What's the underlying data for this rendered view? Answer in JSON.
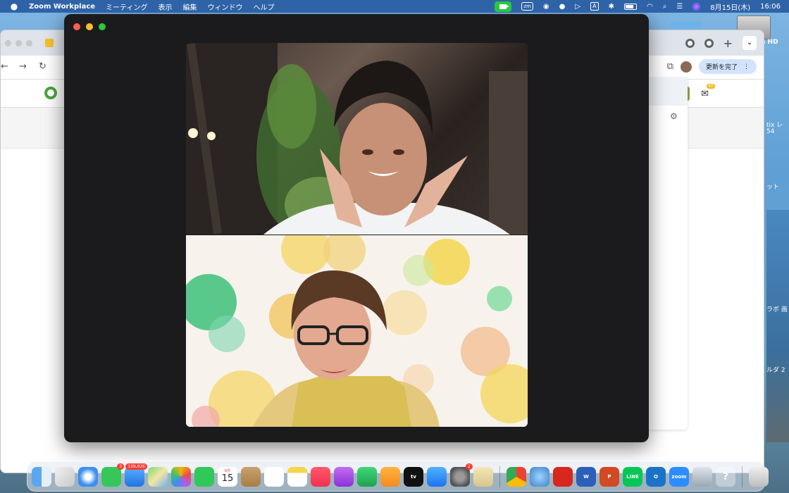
{
  "menubar": {
    "app_name": "Zoom Workplace",
    "menus": [
      "ミーティング",
      "表示",
      "編集",
      "ウィンドウ",
      "ヘルプ"
    ],
    "zoom_icon_text": "zm",
    "input_icon_text": "A",
    "date": "8月15日(木)",
    "time": "16:06"
  },
  "desktop": {
    "disk_label": "n HD",
    "side_labels": [
      "tix レ",
      "54",
      "ット",
      "ラボ 画",
      "ルダ 2"
    ]
  },
  "browser": {
    "update_button": "更新を完了",
    "mail_badge": "40"
  },
  "dock": {
    "items": [
      {
        "name": "finder",
        "label": ""
      },
      {
        "name": "launchpad",
        "label": ""
      },
      {
        "name": "safari",
        "label": ""
      },
      {
        "name": "messages",
        "label": "",
        "badge": "3"
      },
      {
        "name": "mail",
        "label": "",
        "badge": "139,026"
      },
      {
        "name": "maps",
        "label": ""
      },
      {
        "name": "photos",
        "label": ""
      },
      {
        "name": "facetime",
        "label": ""
      },
      {
        "name": "calendar",
        "label": "15",
        "month": "8月"
      },
      {
        "name": "contacts",
        "label": ""
      },
      {
        "name": "reminders",
        "label": ""
      },
      {
        "name": "notes",
        "label": ""
      },
      {
        "name": "music",
        "label": ""
      },
      {
        "name": "podcasts",
        "label": ""
      },
      {
        "name": "numbers",
        "label": ""
      },
      {
        "name": "pages",
        "label": ""
      },
      {
        "name": "tv",
        "label": "tv"
      },
      {
        "name": "app-store",
        "label": ""
      },
      {
        "name": "system-settings",
        "label": "",
        "badge": "2"
      },
      {
        "name": "preview",
        "label": ""
      },
      {
        "name": "chrome",
        "label": ""
      },
      {
        "name": "network-utility",
        "label": ""
      },
      {
        "name": "acrobat",
        "label": ""
      },
      {
        "name": "word",
        "label": "W"
      },
      {
        "name": "powerpoint",
        "label": "P"
      },
      {
        "name": "line",
        "label": "LINE"
      },
      {
        "name": "outlook",
        "label": "O"
      },
      {
        "name": "zoom",
        "label": "zoom"
      },
      {
        "name": "screenshot",
        "label": ""
      },
      {
        "name": "help",
        "label": "?"
      },
      {
        "name": "trash",
        "label": ""
      }
    ]
  },
  "colors": {
    "menubar": "#2f63a8",
    "zoom_window": "#1b1b1d",
    "zoom_live": "#27c840"
  }
}
